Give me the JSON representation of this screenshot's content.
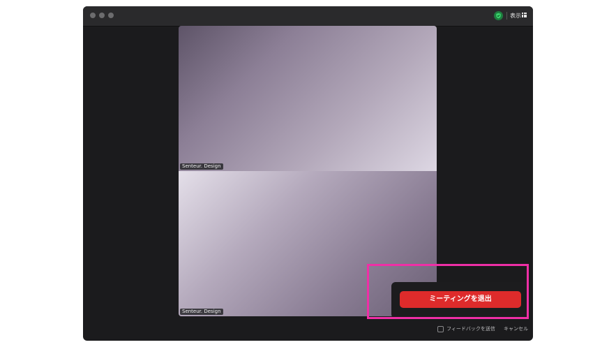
{
  "titlebar": {
    "traffic_lights": [
      "close",
      "minimize",
      "zoom"
    ],
    "security_icon": "shield-check-icon",
    "security_color": "#1e7e3f",
    "view_label": "表示",
    "view_icon": "grid-icon"
  },
  "video_tiles": [
    {
      "name": "Senteur. Design"
    },
    {
      "name": "Senteur. Design"
    }
  ],
  "leave_dialog": {
    "leave_button_label": "ミーティングを退出",
    "leave_button_color": "#de2b2b",
    "feedback_label": "フィードバックを送信",
    "feedback_checked": false,
    "cancel_label": "キャンセル"
  },
  "annotation": {
    "highlight_color": "#ef2fa6"
  }
}
